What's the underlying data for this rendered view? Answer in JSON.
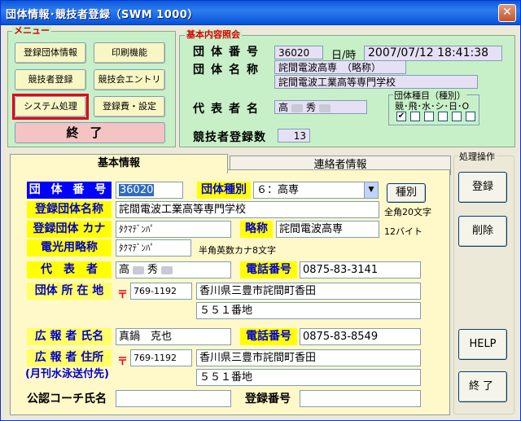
{
  "window": {
    "title": "団体情報･競技者登録（SWM 1000）",
    "close_glyph": "✕"
  },
  "menu": {
    "group_label": "メニュー",
    "items": [
      {
        "label": "登録団体情報"
      },
      {
        "label": "印刷機能"
      },
      {
        "label": "競技者登録"
      },
      {
        "label": "競技会エントリー"
      },
      {
        "label": "システム処理"
      },
      {
        "label": "登録費・設定"
      }
    ],
    "end_label": "終了",
    "highlight_color": "#e3001b"
  },
  "basic_ref": {
    "group_label": "基本内容照会",
    "org_number_label": "団体番号",
    "org_number": "36020",
    "datetime_label": "日/時",
    "datetime": "2007/07/12 18:41:38",
    "org_name_label": "団体名称",
    "org_name_short": "詫間電波高専　（略称）",
    "org_name_full": "詫間電波工業高等専門学校",
    "rep_label": "代表者名",
    "rep_first": "高",
    "rep_last": "秀",
    "athletes_label": "競技者登録数",
    "athletes_count": "13",
    "category_title": "団体種目（種別）",
    "categories": "競･飛･水･シ･日･O",
    "category_checks": [
      true,
      false,
      false,
      false,
      false,
      false
    ]
  },
  "tabs": [
    {
      "label": "基本情報",
      "active": true
    },
    {
      "label": "連絡者情報",
      "active": false
    }
  ],
  "basic": {
    "org_number_label": "団 体 番 号",
    "org_number": "36020",
    "org_type_label": "団体種別",
    "org_type_value": "６：高専",
    "type_button": "種別",
    "reg_name_label": "登録団体名称",
    "reg_name": "詫間電波工業高等専門学校",
    "reg_name_limit": "全角20文字",
    "reg_kana_label": "登録団体 カナ",
    "reg_kana": "ﾀｸﾏﾃﾞﾝﾊﾟ",
    "abbr_label": "略称",
    "abbr": "詫間電波高専",
    "abbr_limit": "12バイト",
    "display_abbr_label": "電光用略称",
    "display_abbr": "ﾀｸﾏﾃﾞﾝﾊﾟ",
    "display_abbr_limit": "半角英数カナ8文字",
    "rep_label": "代　表　者",
    "rep_first": "高",
    "rep_last": "秀",
    "phone_label": "電話番号",
    "phone": "0875-83-3141",
    "address_label": "団体 所 在 地",
    "zip_mark": "〒",
    "zip": "769-1192",
    "address1": "香川県三豊市詫間町香田",
    "address2": "５５１番地",
    "pr_name_label": "広 報 者 氏名",
    "pr_name": "真鍋　克也",
    "pr_phone_label": "電話番号",
    "pr_phone": "0875-83-8549",
    "pr_address_label": "広 報 者 住所",
    "pr_address_sub": "(月刊水泳送付先)",
    "pr_zip": "769-1192",
    "pr_address1": "香川県三豊市詫間町香田",
    "pr_address2": "５５１番地",
    "coach_label": "公認コーチ氏名",
    "coach_value": "",
    "reg_number_label": "登録番号",
    "reg_number_value": ""
  },
  "actions": {
    "label": "処理操作",
    "register": "登録",
    "delete": "削除",
    "help": "HELP",
    "end": "終了"
  }
}
